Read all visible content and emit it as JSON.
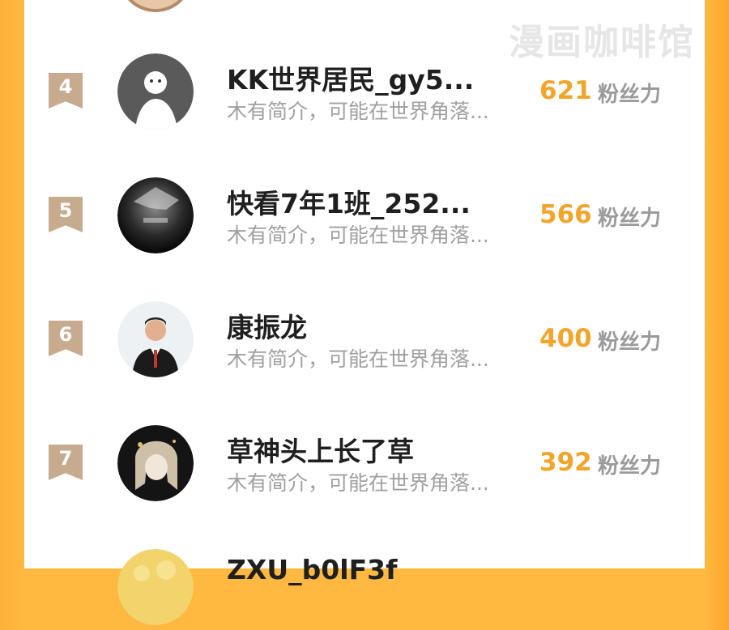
{
  "watermark": "漫画咖啡馆",
  "unit_label": "粉丝力",
  "colors": {
    "accent": "#f2a52b",
    "badge": "#c6ab8f",
    "frame": "#ffb840"
  },
  "rows": [
    {
      "rank": "4",
      "name": "KK世界居民_gy5...",
      "bio": "木有简介，可能在世界角落...",
      "score": "621"
    },
    {
      "rank": "5",
      "name": "快看7年1班_252...",
      "bio": "木有简介，可能在世界角落...",
      "score": "566"
    },
    {
      "rank": "6",
      "name": "康振龙",
      "bio": "木有简介，可能在世界角落...",
      "score": "400"
    },
    {
      "rank": "7",
      "name": "草神头上长了草",
      "bio": "木有简介，可能在世界角落...",
      "score": "392"
    }
  ],
  "next_row": {
    "name": "ZXU_b0lF3f"
  }
}
